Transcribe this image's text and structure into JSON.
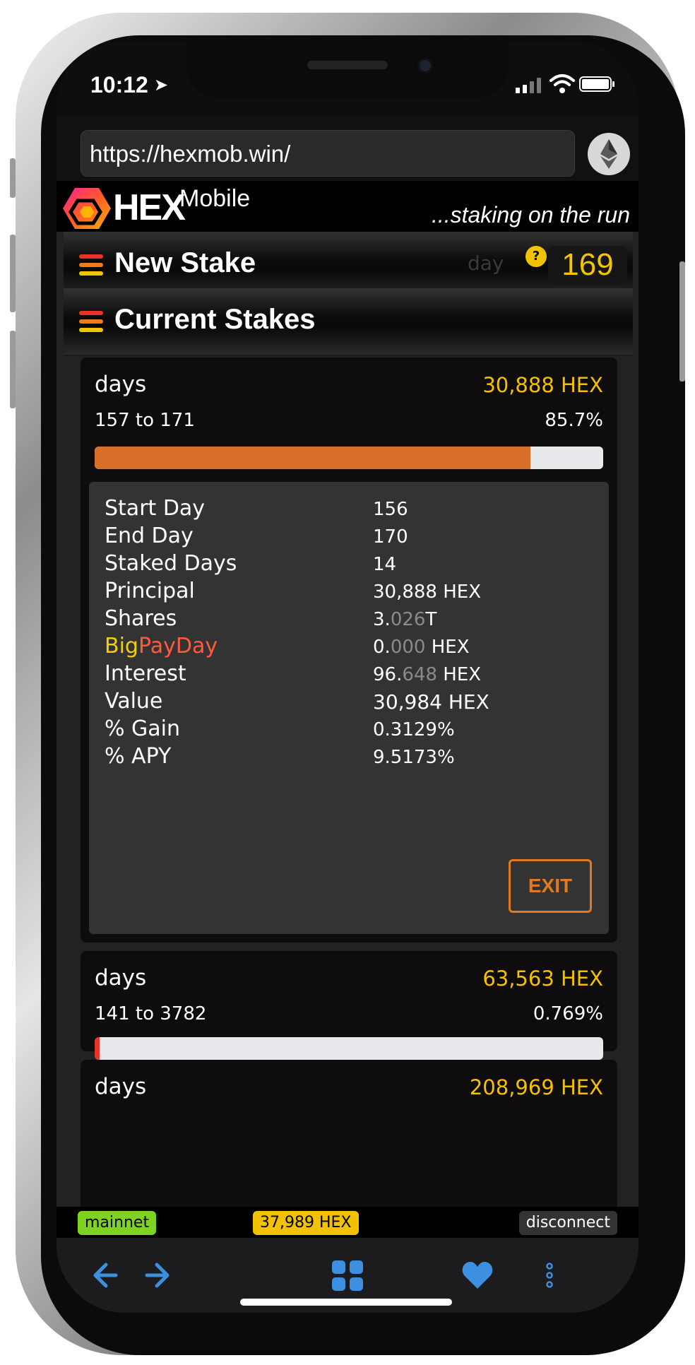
{
  "status_bar": {
    "time": "10:12"
  },
  "browser": {
    "url": "https://hexmob.win/"
  },
  "header": {
    "brand": "HEX",
    "brand_sub": "Mobile",
    "tagline": "...staking on the run"
  },
  "new_stake": {
    "title": "New Stake",
    "day_label": "day",
    "day_help": "?",
    "day_number": "169"
  },
  "current_stakes": {
    "title": "Current Stakes",
    "stakes": [
      {
        "days_label": "days",
        "amount": "30,888 HEX",
        "range": "157 to 171",
        "percent": "85.7%",
        "progress": 0.857,
        "bar_color": "#d86f2a",
        "details": {
          "start_day_label": "Start Day",
          "start_day": "156",
          "end_day_label": "End Day",
          "end_day": "170",
          "staked_days_label": "Staked Days",
          "staked_days": "14",
          "principal_label": "Principal",
          "principal": "30,888 HEX",
          "shares_label": "Shares",
          "shares_int": "3.",
          "shares_frac": "026",
          "shares_unit": "T",
          "bpd_label_a": "Big",
          "bpd_label_b": "PayDay",
          "bpd_int": "0.",
          "bpd_frac": "000",
          "bpd_unit": " HEX",
          "interest_label": "Interest",
          "interest_int": "96.",
          "interest_frac": "648",
          "interest_unit": " HEX",
          "value_label": "Value",
          "value": "30,984 HEX",
          "gain_label": "% Gain",
          "gain": "0.3129%",
          "apy_label": "% APY",
          "apy": "9.5173%",
          "exit_label": "EXIT"
        }
      },
      {
        "days_label": "days",
        "amount": "63,563 HEX",
        "range": "141 to 3782",
        "percent": "0.769%",
        "progress": 0.00769,
        "bar_color": "#e8322a"
      },
      {
        "days_label": "days",
        "amount": "208,969 HEX"
      }
    ]
  },
  "footer": {
    "network": "mainnet",
    "balance": "37,989 HEX",
    "disconnect": "disconnect"
  },
  "toolbar_icons": [
    "back-arrow-icon",
    "forward-arrow-icon",
    "tabs-grid-icon",
    "heart-icon",
    "more-vertical-icon"
  ],
  "colors": {
    "accent": "#f5c400",
    "orange": "#e07a22",
    "toolbar_blue": "#3d8fe0",
    "mainnet_green": "#7ed321"
  }
}
